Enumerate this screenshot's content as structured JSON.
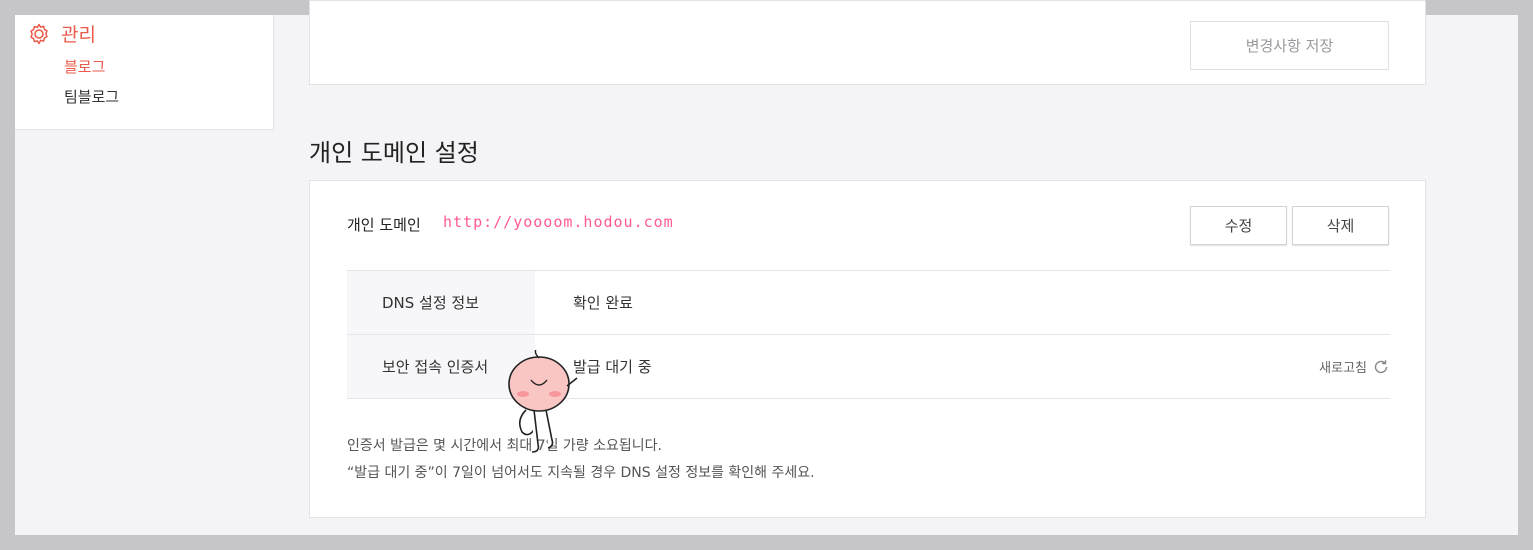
{
  "sidebar": {
    "title": "관리",
    "items": [
      {
        "label": "블로그",
        "active": true
      },
      {
        "label": "팀블로그",
        "active": false
      }
    ]
  },
  "top_card": {
    "save_label": "변경사항 저장"
  },
  "section": {
    "title": "개인 도메인 설정"
  },
  "domain": {
    "label": "개인 도메인",
    "value": "http://yoooom.hodou.com",
    "edit_label": "수정",
    "delete_label": "삭제"
  },
  "rows": [
    {
      "key": "DNS 설정 정보",
      "value": "확인 완료"
    },
    {
      "key": "보안 접속 인증서",
      "value": "발급 대기 중",
      "action": "새로고침"
    }
  ],
  "notes": [
    "인증서 발급은 몇 시간에서 최대 7일 가량 소요됩니다.",
    "“발급 대기 중”이 7일이 넘어서도 지속될 경우 DNS 설정 정보를 확인해 주세요."
  ],
  "colors": {
    "accent": "#eb5a4a",
    "page_bg": "#f4f4f6"
  }
}
